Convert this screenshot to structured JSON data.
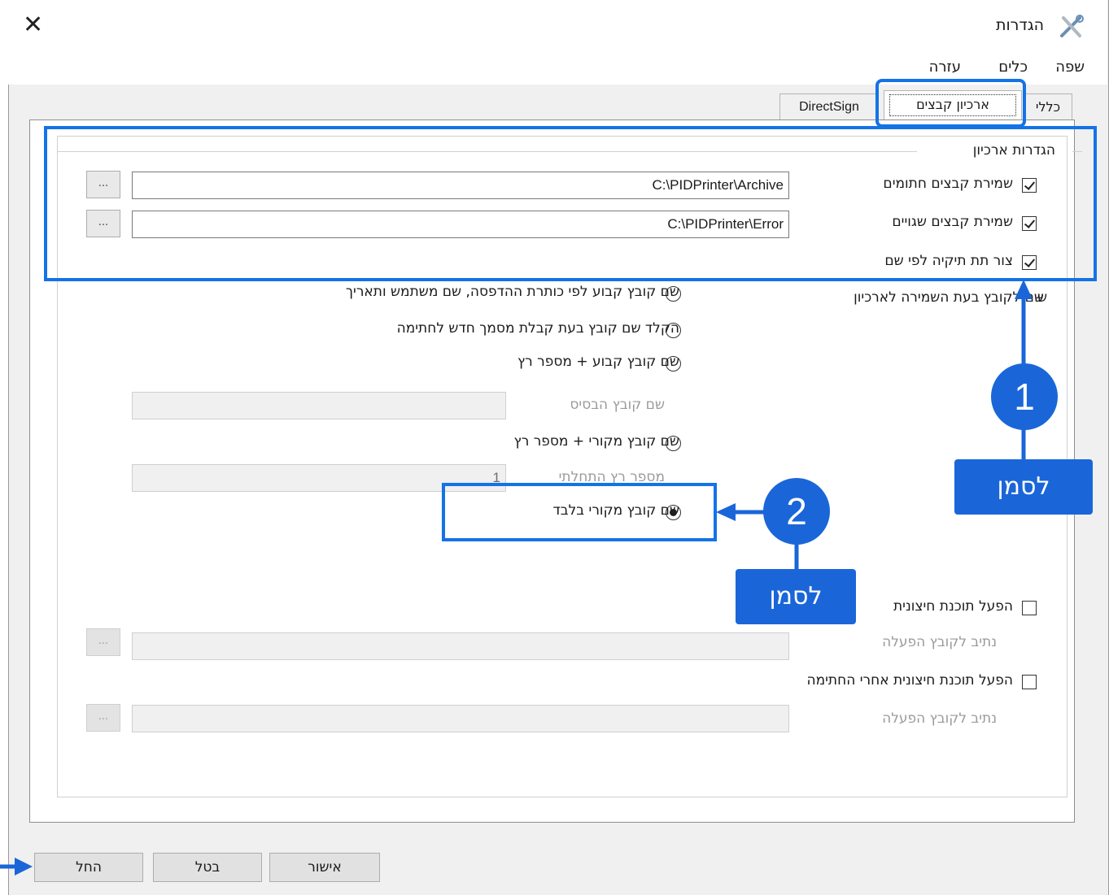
{
  "window": {
    "title": "הגדרות",
    "close_icon": "close-icon",
    "app_icon": "tools-icon"
  },
  "menu": [
    "שפה",
    "כלים",
    "עזרה"
  ],
  "tabs": [
    {
      "label": "כללי",
      "active": false
    },
    {
      "label": "ארכיון קבצים",
      "active": true
    },
    {
      "label": "DirectSign",
      "active": false
    }
  ],
  "archive_group": {
    "legend": "הגדרות ארכיון",
    "save_signed": {
      "label": "שמירת קבצים חתומים",
      "checked": true,
      "path": "C:\\PIDPrinter\\Archive",
      "browse": "..."
    },
    "save_errors": {
      "label": "שמירת קבצים שגויים",
      "checked": true,
      "path": "C:\\PIDPrinter\\Error",
      "browse": "..."
    },
    "create_subfolder": {
      "label": "צור תת תיקיה לפי שם",
      "checked": true
    }
  },
  "naming": {
    "heading": "שם לקובץ בעת השמירה לארכיון",
    "heading_prefix": "ש",
    "options": [
      "שם קובץ קבוע לפי כותרת ההדפסה, שם משתמש ותאריך",
      "הקלד שם קובץ בעת קבלת מסמך חדש לחתימה",
      "שם קובץ קבוע + מספר רץ",
      "שם קובץ מקורי + מספר רץ",
      "שם קובץ מקורי בלבד"
    ],
    "selected_index": 4,
    "base_name_label": "שם קובץ הבסיס",
    "base_name_value": "",
    "start_number_label": "מספר רץ התחלתי",
    "start_number_value": "1"
  },
  "external": {
    "run_external_label": "הפעל תוכנת חיצונית",
    "run_external_checked": false,
    "run_path_label": "נתיב לקובץ הפעלה",
    "run_after_label": "הפעל תוכנת חיצונית אחרי החתימה",
    "run_after_checked": false,
    "run_after_path_label": "נתיב לקובץ הפעלה",
    "browse": "..."
  },
  "buttons": {
    "ok": "אישור",
    "cancel": "בטל",
    "apply": "החל"
  },
  "annotations": [
    {
      "number": "1",
      "tag": "לסמן"
    },
    {
      "number": "2",
      "tag": "לסמן"
    }
  ],
  "colors": {
    "annotation_blue": "#1a66d9",
    "highlight_blue": "#1473e6"
  }
}
